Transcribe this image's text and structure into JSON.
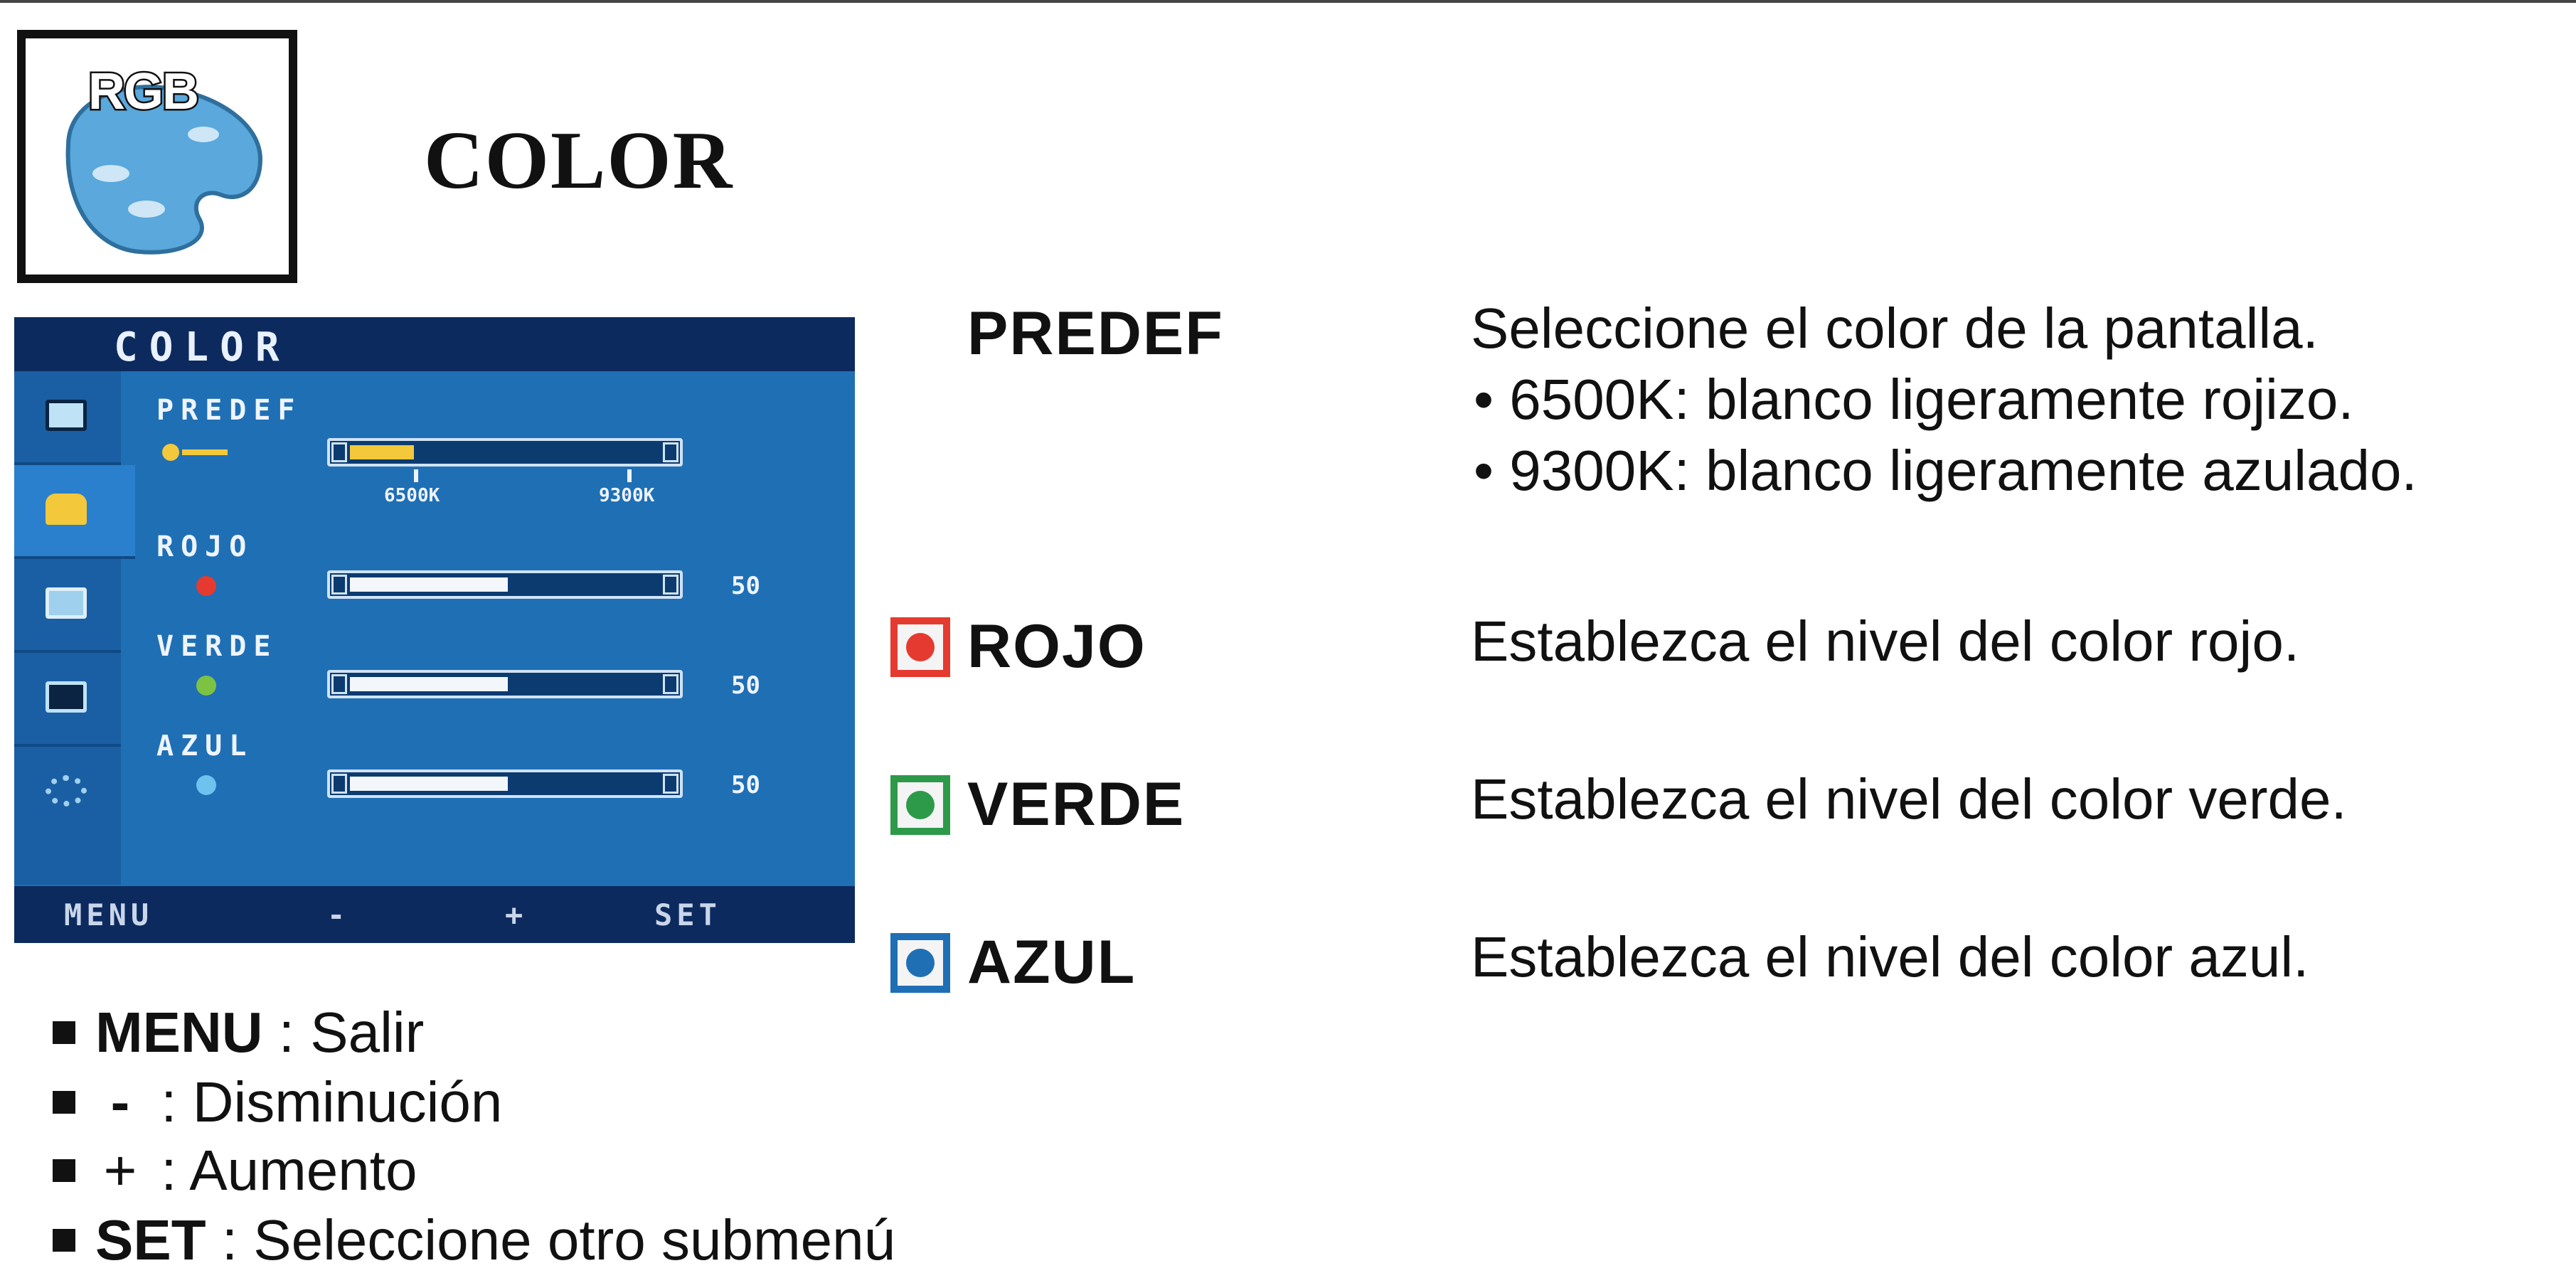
{
  "header": {
    "icon_label": "RGB",
    "title": "COLOR"
  },
  "osd": {
    "title": "COLOR",
    "rows": [
      {
        "label": "PREDEF",
        "dot_color": "#f3c83a",
        "ticks": [
          "6500K",
          "9300K"
        ]
      },
      {
        "label": "ROJO",
        "dot_color": "#e53a2f",
        "value": "50",
        "level": 0.5
      },
      {
        "label": "VERDE",
        "dot_color": "#7dc242",
        "value": "50",
        "level": 0.5
      },
      {
        "label": "AZUL",
        "dot_color": "#6ec2ee",
        "value": "50",
        "level": 0.5
      }
    ],
    "bottom_buttons": [
      "MENU",
      "-",
      "+",
      "SET"
    ]
  },
  "items": [
    {
      "name": "PREDEF",
      "description": [
        "Seleccione el color de la pantalla.",
        "• 6500K: blanco ligeramente rojizo.",
        "• 9300K: blanco ligeramente azulado."
      ]
    },
    {
      "name": "ROJO",
      "swatch_color": "#e53a2f",
      "description": [
        "Establezca el nivel del color rojo."
      ]
    },
    {
      "name": "VERDE",
      "swatch_color": "#2d9a4a",
      "description": [
        "Establezca el nivel del color verde."
      ]
    },
    {
      "name": "AZUL",
      "swatch_color": "#1f6fb5",
      "description": [
        "Establezca el nivel del color azul."
      ]
    }
  ],
  "legend": [
    {
      "key": "MENU",
      "text": ": Salir"
    },
    {
      "key": "-",
      "text": ": Disminución"
    },
    {
      "key": "+",
      "text": ": Aumento"
    },
    {
      "key": "SET",
      "text": ": Seleccione otro submenú"
    }
  ],
  "colors": {
    "osd_background": "#1f6fb5",
    "osd_bar": "#0c2a5e",
    "icon_palette": "#5aa8dc"
  },
  "icons": [
    "palette-icon",
    "monitor-icon",
    "color-tab-icon",
    "picture-icon",
    "display-icon",
    "settings-gear-icon"
  ]
}
